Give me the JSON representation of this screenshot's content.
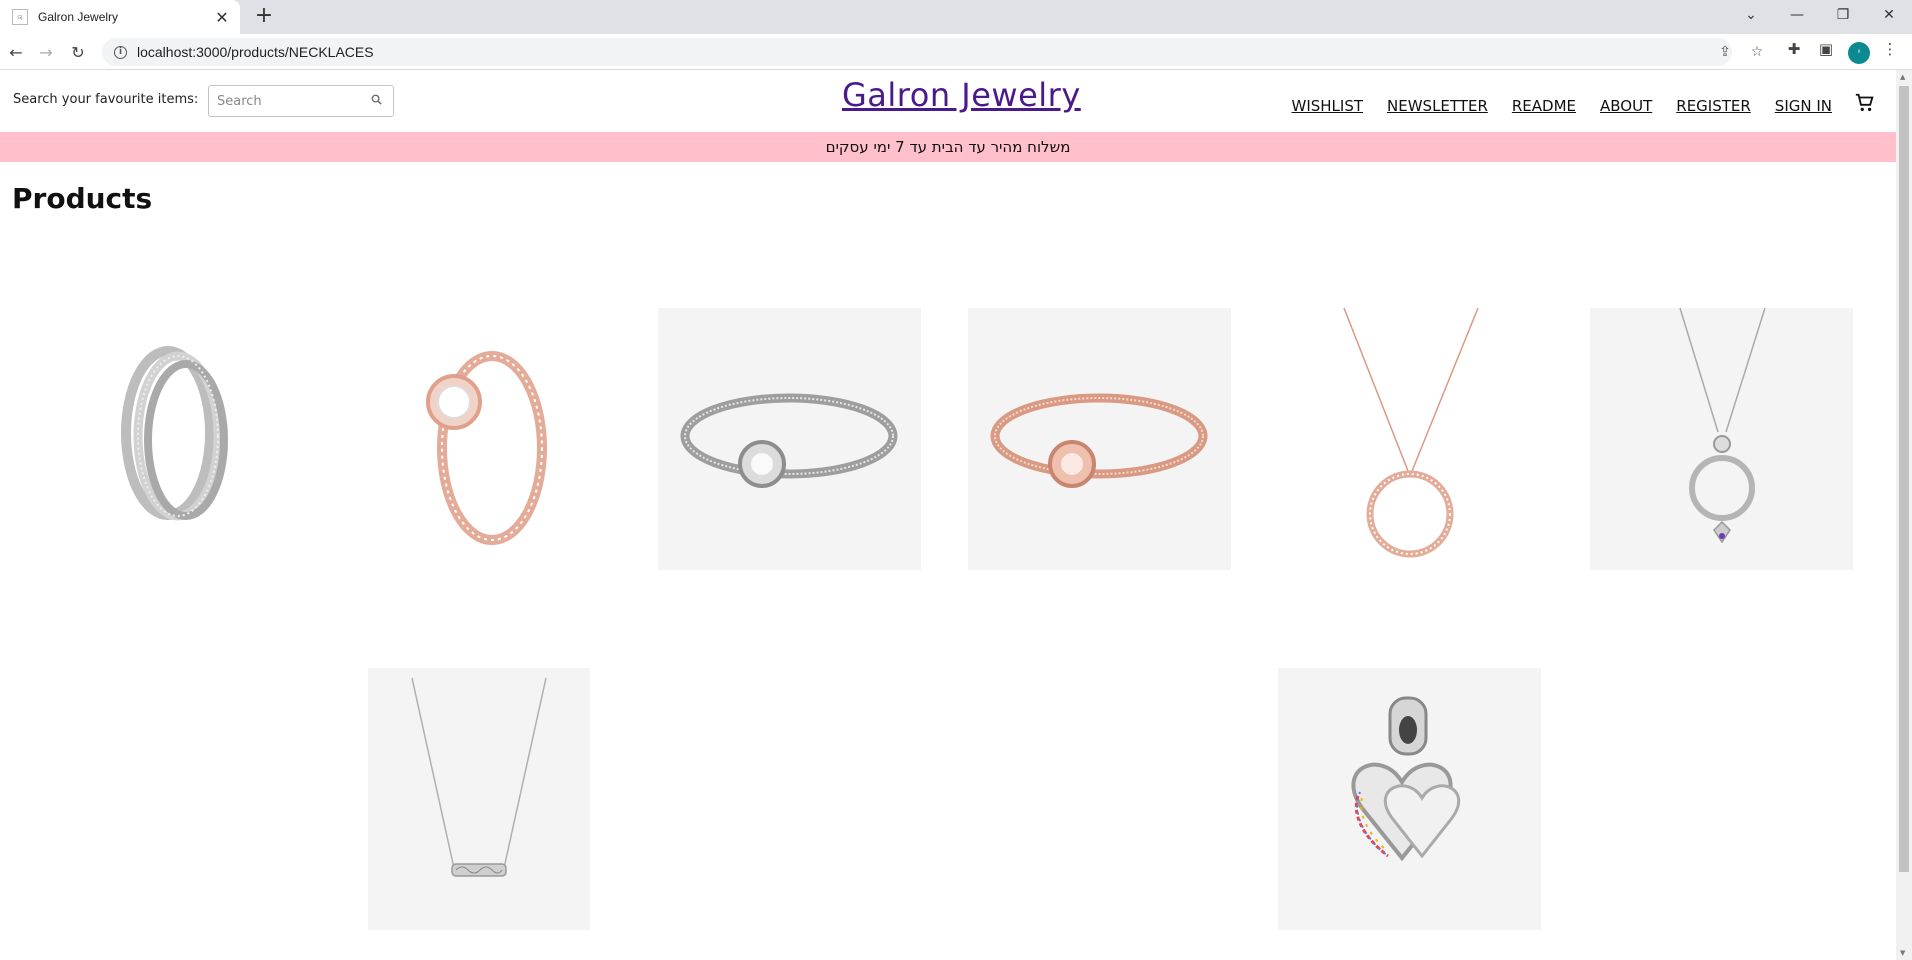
{
  "browser": {
    "tab_title": "Galron Jewelry",
    "url": "localhost:3000/products/NECKLACES",
    "avatar_letter": "י"
  },
  "header": {
    "search_label": "Search your favourite items:",
    "search_placeholder": "Search",
    "brand": "Galron Jewelry",
    "nav": [
      "WISHLIST",
      "NEWSLETTER",
      "README",
      "ABOUT",
      "REGISTER",
      "SIGN IN"
    ]
  },
  "banner": {
    "text": "משלוח מהיר עד הבית עד 7 ימי עסקים"
  },
  "main": {
    "title": "Products"
  },
  "products": [
    {
      "name": "silver-interlocking-ring",
      "kind": "ring-silver"
    },
    {
      "name": "rose-gold-halo-ring",
      "kind": "ring-rose"
    },
    {
      "name": "silver-snake-chain-bracelet",
      "kind": "bracelet-silver"
    },
    {
      "name": "rose-gold-snake-chain-bracelet",
      "kind": "bracelet-rose"
    },
    {
      "name": "rose-gold-circle-necklace",
      "kind": "necklace-rose-circle"
    },
    {
      "name": "silver-o-pendant-necklace",
      "kind": "necklace-silver-o"
    },
    {
      "name": "silver-bar-necklace",
      "kind": "necklace-silver-bar"
    },
    {
      "name": "heart-friendship-charm",
      "kind": "charm-heart"
    }
  ],
  "colors": {
    "brand": "#4a1a8c",
    "banner_bg": "#ffc0cb",
    "card_bg": "#f4f4f4",
    "rose_gold": "#e0a08c",
    "silver": "#b8b8b8"
  }
}
